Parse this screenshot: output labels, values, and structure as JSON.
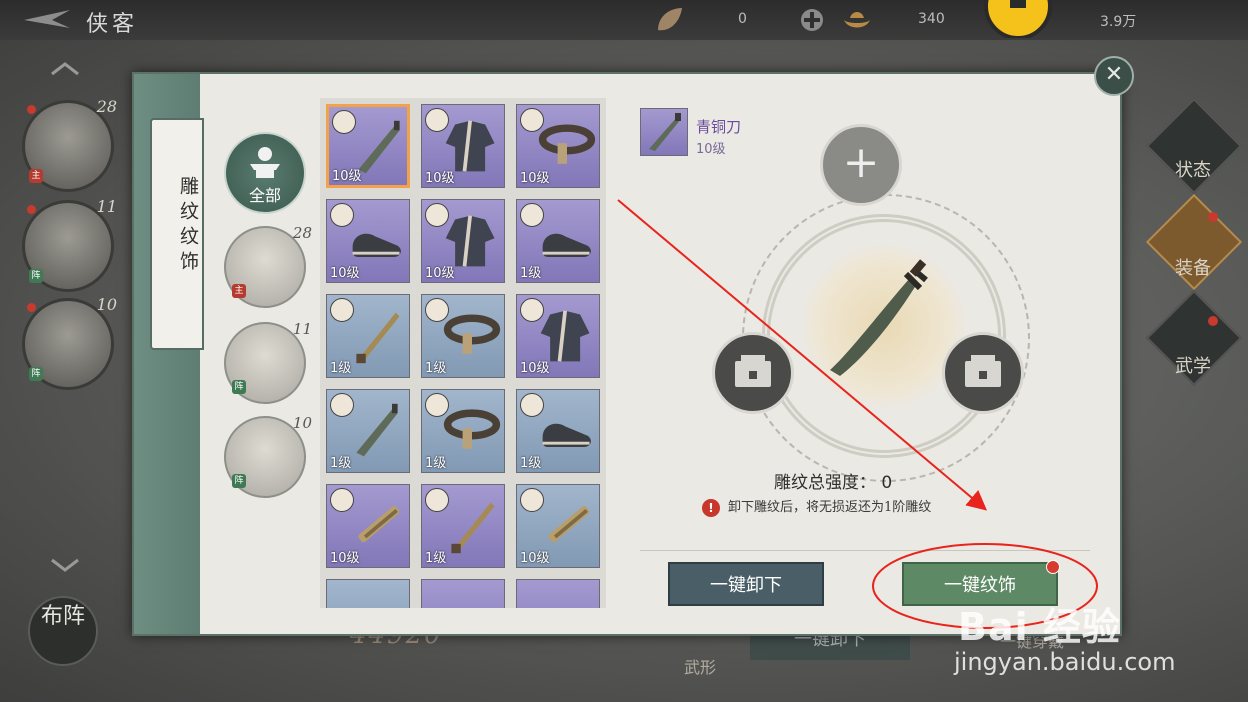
{
  "topbar": {
    "title": "侠客",
    "res1": "0",
    "res2": "340",
    "res3": "3.9万"
  },
  "roster": [
    {
      "level": "28",
      "tag": "主"
    },
    {
      "level": "11",
      "tag": "阵"
    },
    {
      "level": "10",
      "tag": "阵"
    }
  ],
  "deploy_label": "布阵",
  "right_menu": [
    {
      "label": "状态"
    },
    {
      "label": "装备"
    },
    {
      "label": "武学"
    }
  ],
  "behind": {
    "power": "44920",
    "unload": "一键卸下",
    "martial": "武形",
    "equip": "一键穿戴"
  },
  "modal": {
    "side_tab": "雕纹纹饰",
    "filters": [
      {
        "label": "全部"
      },
      {
        "level": "28",
        "tag": "主"
      },
      {
        "level": "11",
        "tag": "阵"
      },
      {
        "level": "10",
        "tag": "阵"
      }
    ],
    "items": [
      {
        "level": "10级",
        "color": "purple",
        "kind": "blade"
      },
      {
        "level": "10级",
        "color": "purple",
        "kind": "robe"
      },
      {
        "level": "10级",
        "color": "purple",
        "kind": "belt"
      },
      {
        "level": "10级",
        "color": "purple",
        "kind": "shoe"
      },
      {
        "level": "10级",
        "color": "purple",
        "kind": "robe"
      },
      {
        "level": "1级",
        "color": "purple",
        "kind": "shoe"
      },
      {
        "level": "1级",
        "color": "blue",
        "kind": "sword"
      },
      {
        "level": "1级",
        "color": "blue",
        "kind": "belt"
      },
      {
        "level": "10级",
        "color": "purple",
        "kind": "robe"
      },
      {
        "level": "1级",
        "color": "blue",
        "kind": "blade"
      },
      {
        "level": "1级",
        "color": "blue",
        "kind": "belt"
      },
      {
        "level": "1级",
        "color": "blue",
        "kind": "shoe"
      },
      {
        "level": "10级",
        "color": "purple",
        "kind": "staff"
      },
      {
        "level": "1级",
        "color": "purple",
        "kind": "sword"
      },
      {
        "level": "10级",
        "color": "blue",
        "kind": "staff"
      }
    ],
    "selected": {
      "name": "青铜刀",
      "level": "10级"
    },
    "strength_label": "雕纹总强度：",
    "strength_value": "0",
    "notice": "卸下雕纹后，将无损返还为1阶雕纹",
    "btn_unload": "一键卸下",
    "btn_engrave": "一键纹饰",
    "close": "✕"
  },
  "watermark": {
    "logo": "Bai 经验",
    "url": "jingyan.baidu.com"
  },
  "colors": {
    "annotation": "#e8241c",
    "purple_item": "#8f85c2",
    "blue_item": "#8ea3bd"
  }
}
